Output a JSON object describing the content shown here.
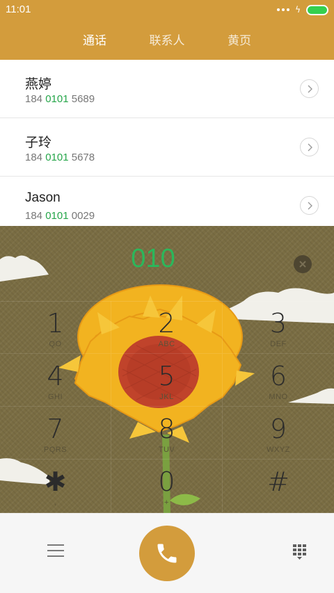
{
  "status_bar": {
    "time": "11:01",
    "battery_color": "#34d04e"
  },
  "header": {
    "bg_color": "#d39c3c",
    "tabs": [
      {
        "label": "通话",
        "active": true
      },
      {
        "label": "联系人",
        "active": false
      },
      {
        "label": "黄页",
        "active": false
      }
    ]
  },
  "contacts": [
    {
      "name": "燕婷",
      "num_prefix": "184 ",
      "num_match": "0101",
      "num_suffix": " 5689"
    },
    {
      "name": "子玲",
      "num_prefix": "184 ",
      "num_match": "0101",
      "num_suffix": " 5678"
    },
    {
      "name": "Jason",
      "num_prefix": "184 ",
      "num_match": "0101",
      "num_suffix": " 0029"
    }
  ],
  "dialer": {
    "input": "010",
    "match_color": "#26a64a",
    "keys": [
      {
        "digit": "1",
        "letters": "QO"
      },
      {
        "digit": "2",
        "letters": "ABC"
      },
      {
        "digit": "3",
        "letters": "DEF"
      },
      {
        "digit": "4",
        "letters": "GHI"
      },
      {
        "digit": "5",
        "letters": "JKL"
      },
      {
        "digit": "6",
        "letters": "MNO"
      },
      {
        "digit": "7",
        "letters": "PQRS"
      },
      {
        "digit": "8",
        "letters": "TUV"
      },
      {
        "digit": "9",
        "letters": "WXYZ"
      },
      {
        "digit": "✱",
        "letters": ","
      },
      {
        "digit": "0",
        "letters": "+"
      },
      {
        "digit": "#",
        "letters": ""
      }
    ]
  },
  "bottom_bar": {
    "icons": [
      "menu-icon",
      "phone-icon",
      "dialpad-icon"
    ],
    "accent_color": "#d39c3c"
  }
}
